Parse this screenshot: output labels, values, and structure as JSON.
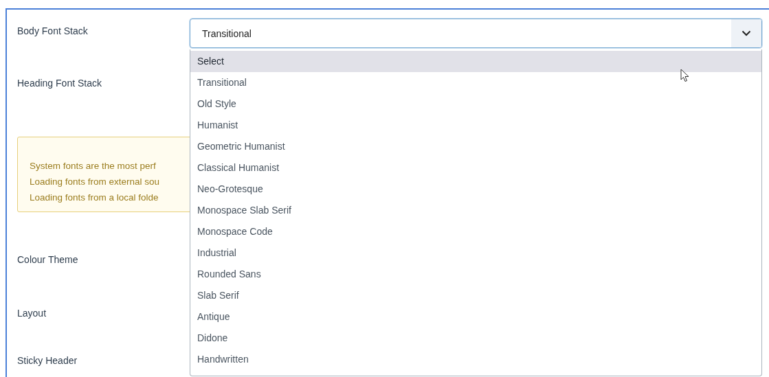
{
  "body_font_stack": {
    "label": "Body Font Stack",
    "value": "Transitional",
    "expanded": true,
    "options": [
      {
        "label": "Select",
        "highlighted": true
      },
      {
        "label": "Transitional",
        "highlighted": false
      },
      {
        "label": "Old Style",
        "highlighted": false
      },
      {
        "label": "Humanist",
        "highlighted": false
      },
      {
        "label": "Geometric Humanist",
        "highlighted": false
      },
      {
        "label": "Classical Humanist",
        "highlighted": false
      },
      {
        "label": "Neo-Grotesque",
        "highlighted": false
      },
      {
        "label": "Monospace Slab Serif",
        "highlighted": false
      },
      {
        "label": "Monospace Code",
        "highlighted": false
      },
      {
        "label": "Industrial",
        "highlighted": false
      },
      {
        "label": "Rounded Sans",
        "highlighted": false
      },
      {
        "label": "Slab Serif",
        "highlighted": false
      },
      {
        "label": "Antique",
        "highlighted": false
      },
      {
        "label": "Didone",
        "highlighted": false
      },
      {
        "label": "Handwritten",
        "highlighted": false
      }
    ]
  },
  "heading_font_stack": {
    "label": "Heading Font Stack"
  },
  "alert": {
    "lines": [
      "System fonts are the most perf",
      "Loading fonts from external sou",
      "Loading fonts from a local folde"
    ]
  },
  "fields": [
    {
      "label": "Colour Theme"
    },
    {
      "label": "Layout"
    },
    {
      "label": "Sticky Header"
    }
  ]
}
